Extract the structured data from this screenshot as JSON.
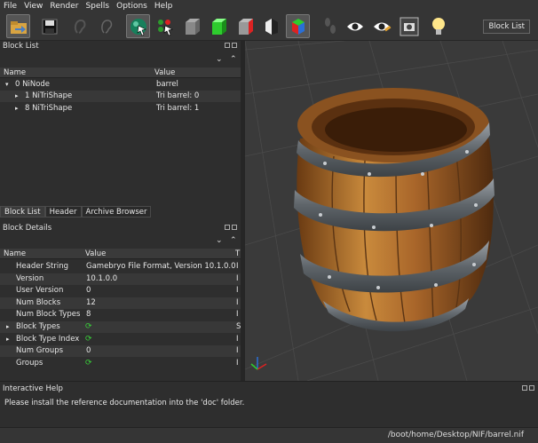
{
  "menu": [
    "File",
    "View",
    "Render",
    "Spells",
    "Options",
    "Help"
  ],
  "toolbar": {
    "icons": [
      "load-icon",
      "save-icon",
      "ear-icon",
      "ear-outline-icon",
      "select-object-icon",
      "select-vertex-icon",
      "cube-gray-icon",
      "cube-green-icon",
      "cube-red-icon",
      "cube-bw-icon",
      "cube-rgb-icon",
      "footprints-icon",
      "eye-icon",
      "eye-edit-icon",
      "screenshot-icon",
      "lightbulb-icon"
    ],
    "block_list_button": "Block List"
  },
  "block_list": {
    "title": "Block List",
    "columns": [
      "Name",
      "Value"
    ],
    "rows": [
      {
        "name": "0 NiNode",
        "value": "barrel",
        "expanded": true
      },
      {
        "name": "1 NiTriShape",
        "value": "Tri barrel: 0",
        "expanded": false
      },
      {
        "name": "8 NiTriShape",
        "value": "Tri barrel: 1",
        "expanded": false
      }
    ]
  },
  "tabs": [
    "Block List",
    "Header",
    "Archive Browser"
  ],
  "block_details": {
    "title": "Block Details",
    "columns": [
      "Name",
      "Value",
      "T"
    ],
    "rows": [
      {
        "name": "Header String",
        "value": "Gamebryo File Format, Version 10.1.0.0",
        "t": "I"
      },
      {
        "name": "Version",
        "value": "10.1.0.0",
        "t": "I"
      },
      {
        "name": "User Version",
        "value": "0",
        "t": "I"
      },
      {
        "name": "Num Blocks",
        "value": "12",
        "t": "I"
      },
      {
        "name": "Num Block Types",
        "value": "8",
        "t": "I"
      },
      {
        "name": "Block Types",
        "value": "",
        "t": "S"
      },
      {
        "name": "Block Type Index",
        "value": "",
        "t": "I"
      },
      {
        "name": "Num Groups",
        "value": "0",
        "t": "I"
      },
      {
        "name": "Groups",
        "value": "",
        "t": "I"
      }
    ]
  },
  "interactive_help": {
    "title": "Interactive Help",
    "message": "Please install the reference documentation into the 'doc' folder."
  },
  "status": {
    "path": "/boot/home/Desktop/NIF/barrel.nif"
  },
  "colors": {
    "accent_green": "#3ad13a",
    "wood": "#b06a25",
    "metal": "#6b7176"
  }
}
